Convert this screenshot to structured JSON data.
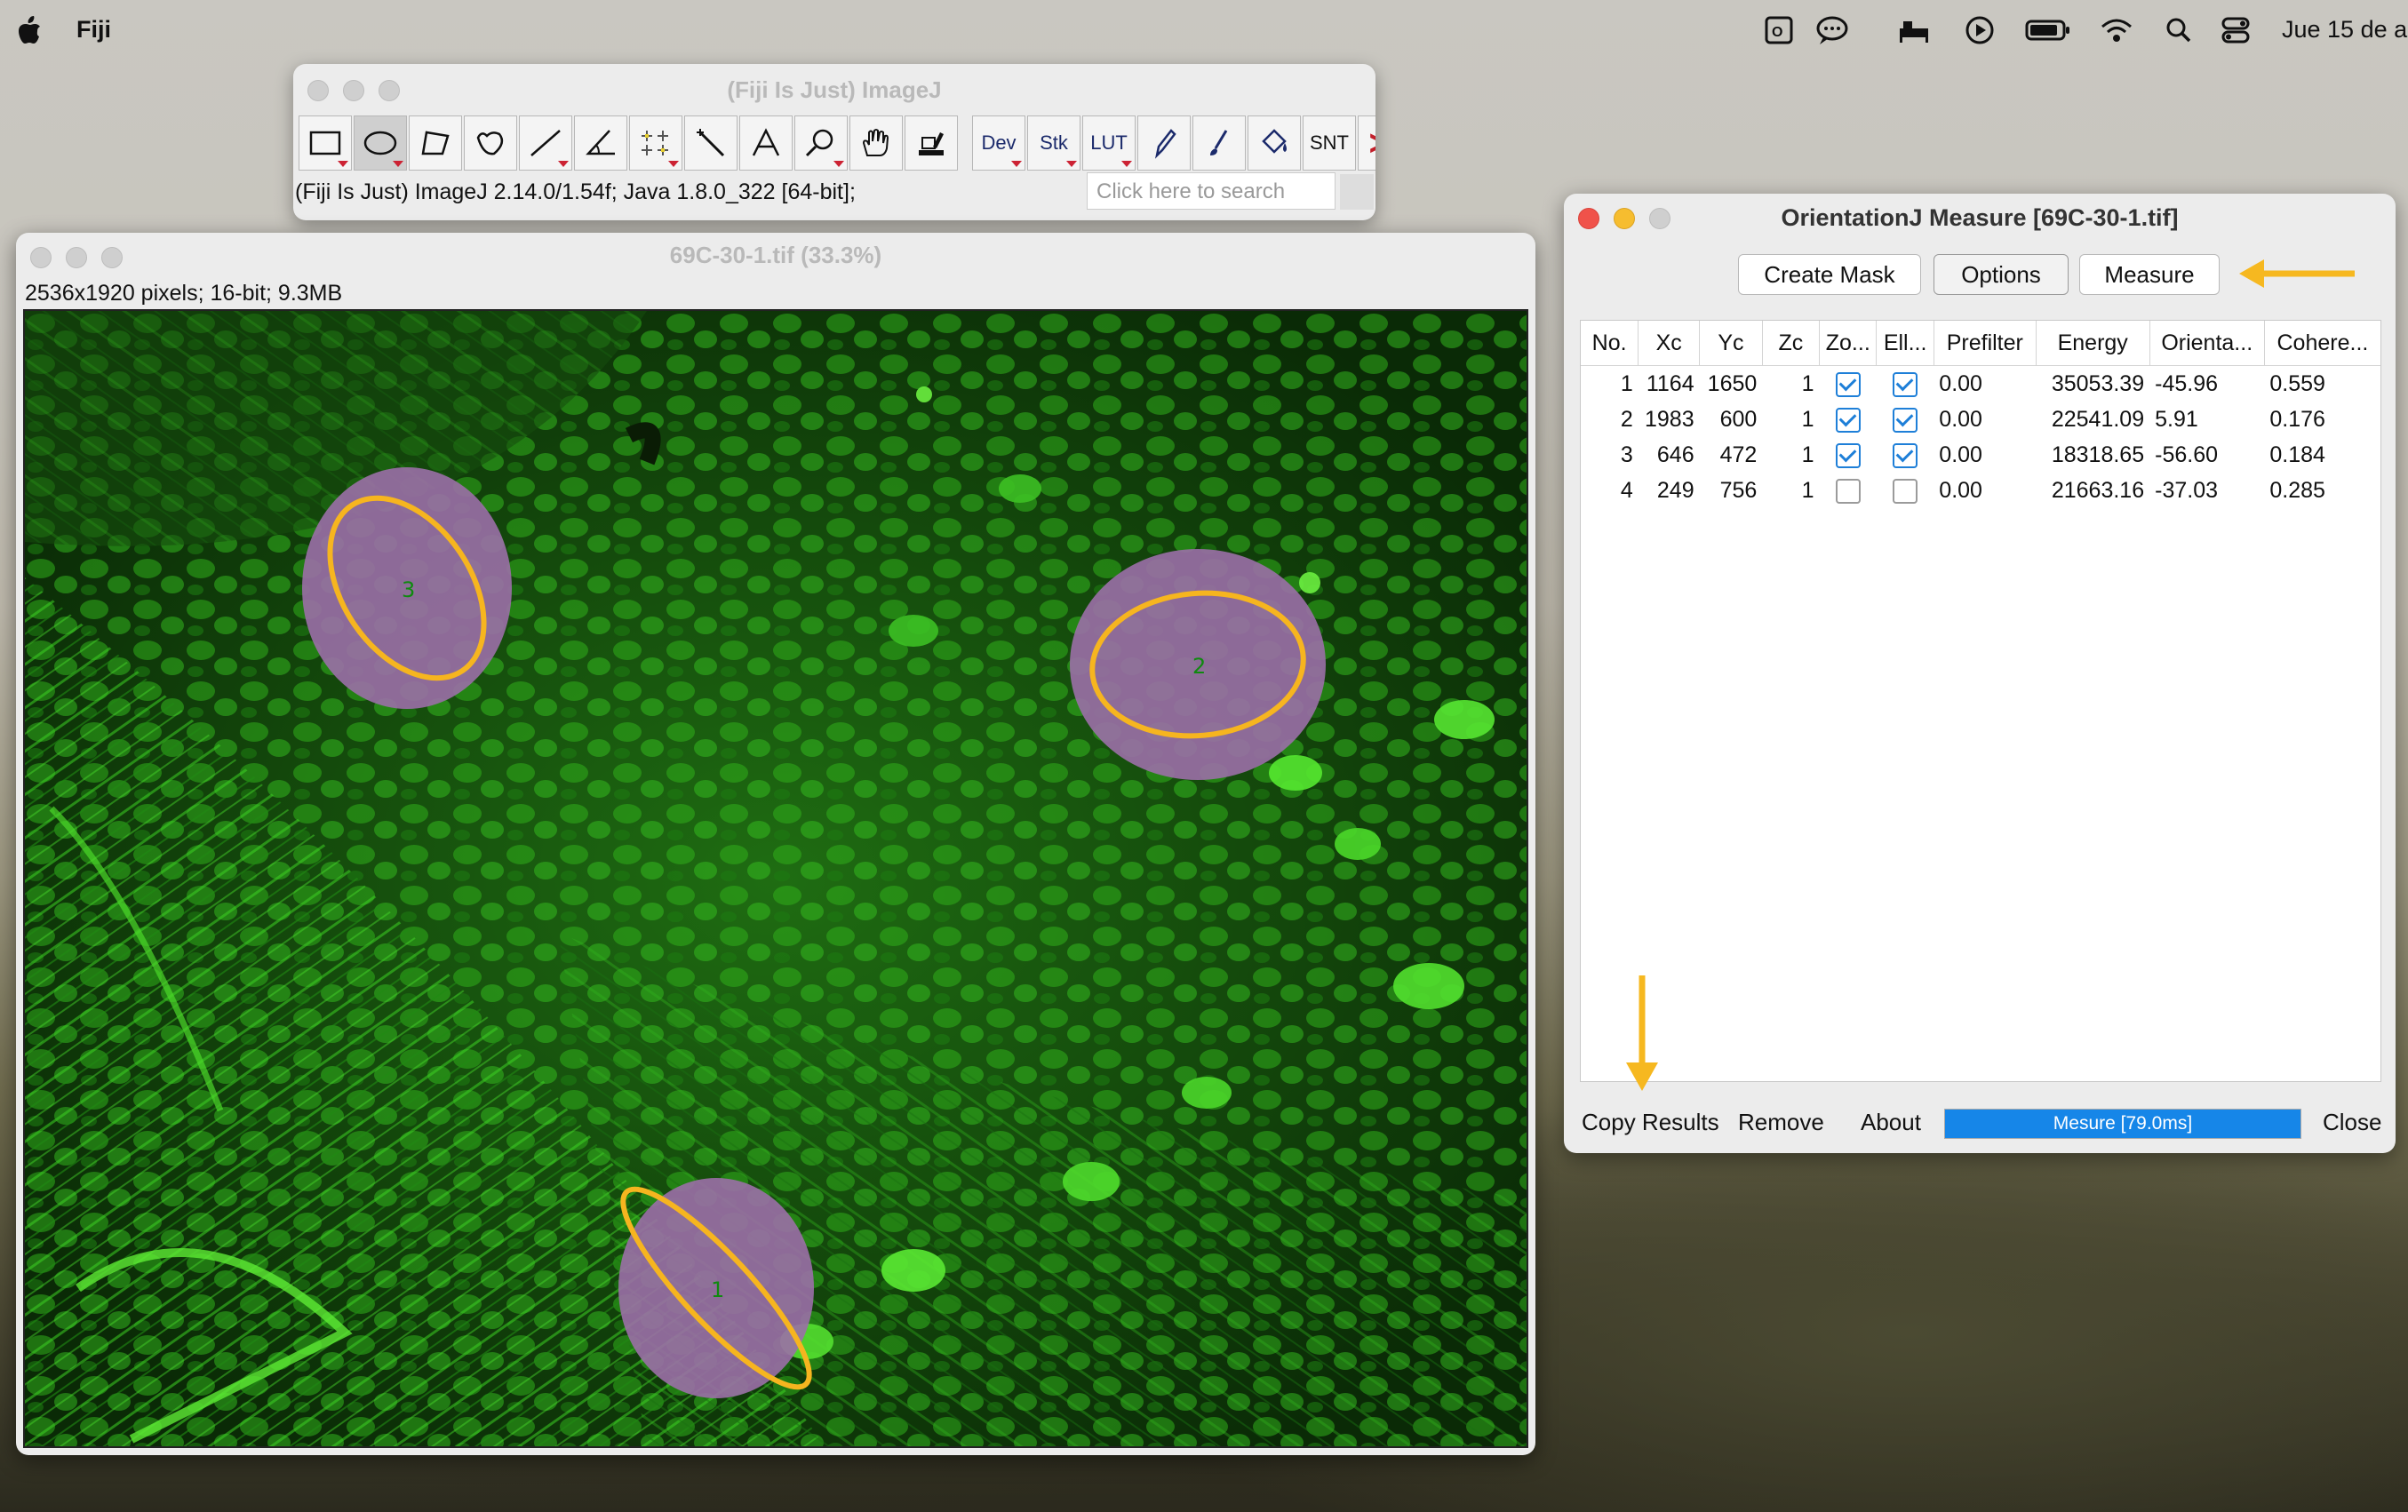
{
  "menubar": {
    "app_name": "Fiji",
    "date": "Jue 15 de a",
    "icons": [
      "apple-logo",
      "outlook-icon",
      "chat-bubble-icon",
      "bed-icon",
      "play-icon",
      "battery-icon",
      "wifi-icon",
      "search-icon",
      "control-center-icon"
    ]
  },
  "imagej": {
    "title": "(Fiji Is Just) ImageJ",
    "status": "(Fiji Is Just) ImageJ 2.14.0/1.54f; Java 1.8.0_322 [64-bit];",
    "search_placeholder": "Click here to search",
    "tools": [
      {
        "name": "rectangle-tool",
        "label": ""
      },
      {
        "name": "oval-tool",
        "label": ""
      },
      {
        "name": "polygon-tool",
        "label": ""
      },
      {
        "name": "freehand-tool",
        "label": ""
      },
      {
        "name": "line-tool",
        "label": ""
      },
      {
        "name": "angle-tool",
        "label": ""
      },
      {
        "name": "point-tool",
        "label": ""
      },
      {
        "name": "wand-tool",
        "label": ""
      },
      {
        "name": "text-tool",
        "label": ""
      },
      {
        "name": "magnifier-tool",
        "label": ""
      },
      {
        "name": "hand-tool",
        "label": ""
      },
      {
        "name": "dropper-tool",
        "label": ""
      },
      {
        "name": "dev-menu",
        "label": "Dev"
      },
      {
        "name": "stk-menu",
        "label": "Stk"
      },
      {
        "name": "lut-menu",
        "label": "LUT"
      },
      {
        "name": "pencil-tool",
        "label": ""
      },
      {
        "name": "brush-tool",
        "label": ""
      },
      {
        "name": "flood-fill-tool",
        "label": ""
      },
      {
        "name": "snt-tool",
        "label": "SNT"
      },
      {
        "name": "more-tools",
        "label": "≫"
      }
    ]
  },
  "image_window": {
    "title": "69C-30-1.tif (33.3%)",
    "info": "2536x1920 pixels; 16-bit; 9.3MB",
    "roi_labels": [
      "3",
      "2",
      "1"
    ]
  },
  "orientationj": {
    "title": "OrientationJ Measure [69C-30-1.tif]",
    "buttons": {
      "create_mask": "Create Mask",
      "options": "Options",
      "measure": "Measure"
    },
    "columns": [
      "No.",
      "Xc",
      "Yc",
      "Zc",
      "Zo...",
      "Ell...",
      "Prefilter",
      "Energy",
      "Orienta...",
      "Cohere..."
    ],
    "rows": [
      {
        "no": "1",
        "xc": "1164",
        "yc": "1650",
        "zc": "1",
        "zoom": true,
        "ellipse": true,
        "prefilter": "0.00",
        "energy": "35053.39",
        "orientation": "-45.96",
        "coherency": "0.559"
      },
      {
        "no": "2",
        "xc": "1983",
        "yc": "600",
        "zc": "1",
        "zoom": true,
        "ellipse": true,
        "prefilter": "0.00",
        "energy": "22541.09",
        "orientation": "5.91",
        "coherency": "0.176"
      },
      {
        "no": "3",
        "xc": "646",
        "yc": "472",
        "zc": "1",
        "zoom": true,
        "ellipse": true,
        "prefilter": "0.00",
        "energy": "18318.65",
        "orientation": "-56.60",
        "coherency": "0.184"
      },
      {
        "no": "4",
        "xc": "249",
        "yc": "756",
        "zc": "1",
        "zoom": false,
        "ellipse": false,
        "prefilter": "0.00",
        "energy": "21663.16",
        "orientation": "-37.03",
        "coherency": "0.285"
      }
    ],
    "bottom": {
      "copy": "Copy Results",
      "remove": "Remove",
      "about": "About",
      "progress": "Mesure [79.0ms]",
      "progress_value": 1.0,
      "close": "Close"
    }
  },
  "colors": {
    "arrow": "#f6b820",
    "roi_fill": "#9b6fa7",
    "roi_outline": "#f6b51f",
    "progress": "#1686e8"
  }
}
